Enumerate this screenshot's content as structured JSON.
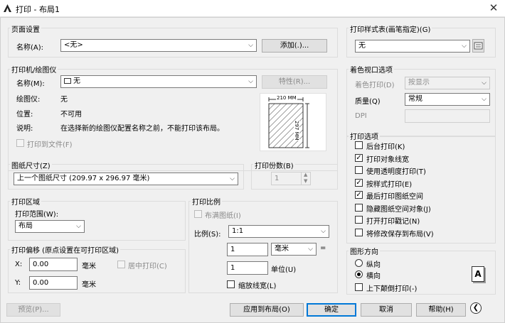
{
  "window": {
    "title": "打印 - 布局1",
    "close_glyph": "✕"
  },
  "page_setup": {
    "group_title": "页面设置",
    "name_label": "名称(A):",
    "name_value": "<无>",
    "add_button": "添加(.)..."
  },
  "printer": {
    "group_title": "打印机/绘图仪",
    "name_label": "名称(M):",
    "name_value": "无",
    "properties_button": "特性(R)...",
    "plotter_label": "绘图仪:",
    "plotter_value": "无",
    "location_label": "位置:",
    "location_value": "不可用",
    "description_label": "说明:",
    "description_value": "在选择新的绘图仪配置名称之前，不能打印该布局。",
    "print_to_file": "打印到文件(F)",
    "preview_width": "210 MM",
    "preview_height": "297 MM"
  },
  "paper_size": {
    "group_title": "图纸尺寸(Z)",
    "value": "上一个图纸尺寸 (209.97 x 296.97 毫米)"
  },
  "copies": {
    "group_title": "打印份数(B)",
    "value": "1"
  },
  "plot_area": {
    "group_title": "打印区域",
    "range_label": "打印范围(W):",
    "range_value": "布局"
  },
  "plot_offset": {
    "group_title": "打印偏移 (原点设置在可打印区域)",
    "x_label": "X:",
    "x_value": "0.00",
    "x_unit": "毫米",
    "y_label": "Y:",
    "y_value": "0.00",
    "y_unit": "毫米",
    "center_label": "居中打印(C)"
  },
  "plot_scale": {
    "group_title": "打印比例",
    "fit_label": "布满图纸(I)",
    "scale_label": "比例(S):",
    "scale_value": "1:1",
    "value1": "1",
    "unit_value": "毫米",
    "equals": "=",
    "value2": "1",
    "unit2_label": "单位(U)",
    "lineweights_label": "缩放线宽(L)"
  },
  "style_table": {
    "group_title": "打印样式表(画笔指定)(G)",
    "value": "无",
    "edit_icon": "edit-style-icon"
  },
  "shaded": {
    "group_title": "着色视口选项",
    "shade_label": "着色打印(D)",
    "shade_value": "按显示",
    "quality_label": "质量(Q)",
    "quality_value": "常规",
    "dpi_label": "DPI"
  },
  "plot_options": {
    "group_title": "打印选项",
    "items": [
      {
        "label": "后台打印(K)",
        "checked": false
      },
      {
        "label": "打印对象线宽",
        "checked": true
      },
      {
        "label": "使用透明度打印(T)",
        "checked": false
      },
      {
        "label": "按样式打印(E)",
        "checked": true
      },
      {
        "label": "最后打印图纸空间",
        "checked": true
      },
      {
        "label": "隐藏图纸空间对象(J)",
        "checked": false
      },
      {
        "label": "打开打印戳记(N)",
        "checked": false
      },
      {
        "label": "将修改保存到布局(V)",
        "checked": false
      }
    ]
  },
  "orientation": {
    "group_title": "图形方向",
    "portrait": "纵向",
    "landscape": "横向",
    "upside_down": "上下颠倒打印(-)",
    "page_glyph": "A"
  },
  "bottom": {
    "preview": "预览(P)...",
    "apply": "应用到布局(O)",
    "ok": "确定",
    "cancel": "取消",
    "help": "帮助(H)"
  },
  "colors": {
    "accent": "#0078d7",
    "group_border": "#dcdcdc",
    "dialog_bg": "#f0f0f0"
  }
}
